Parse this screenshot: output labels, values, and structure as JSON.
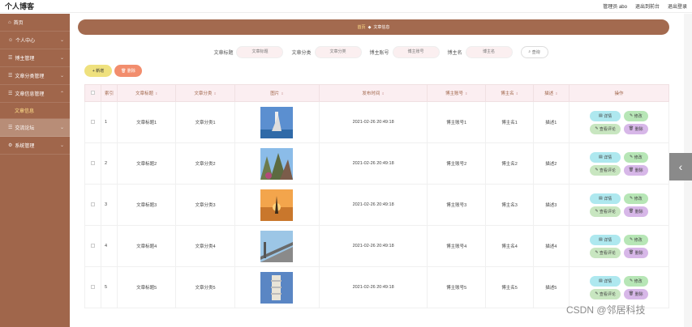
{
  "header": {
    "title": "个人博客",
    "admin": "管理员 abo",
    "back": "退出到前台",
    "logout": "退出登录"
  },
  "sidebar": {
    "items": [
      {
        "label": "首页",
        "icon": "home-icon"
      },
      {
        "label": "个人中心",
        "icon": "user-icon"
      },
      {
        "label": "博主管理",
        "icon": "list-icon"
      },
      {
        "label": "文章分类管理",
        "icon": "list-icon"
      },
      {
        "label": "文章信息管理",
        "icon": "list-icon"
      },
      {
        "label": "文章信息",
        "icon": ""
      },
      {
        "label": "交流论坛",
        "icon": "list-icon"
      },
      {
        "label": "系统管理",
        "icon": "gear-icon"
      }
    ]
  },
  "breadcrumb": {
    "home": "首页",
    "current": "文章信息"
  },
  "filters": {
    "title_label": "文章标题",
    "title_placeholder": "文章标题",
    "cat_label": "文章分类",
    "cat_placeholder": "文章分类",
    "acct_label": "博主账号",
    "acct_placeholder": "博主账号",
    "name_label": "博主名",
    "name_placeholder": "博主名",
    "search": "查询"
  },
  "actions": {
    "add": "新增",
    "delete": "删除"
  },
  "table": {
    "headers": [
      "索引",
      "文章标题",
      "文章分类",
      "图片",
      "发布时间",
      "博主账号",
      "博主名",
      "描述",
      "操作"
    ],
    "rows": [
      {
        "idx": "1",
        "title": "文章标题1",
        "cat": "文章分类1",
        "time": "2021-02-26 20:49:18",
        "acct": "博主账号1",
        "name": "博主名1",
        "desc": "描述1"
      },
      {
        "idx": "2",
        "title": "文章标题2",
        "cat": "文章分类2",
        "time": "2021-02-26 20:49:18",
        "acct": "博主账号2",
        "name": "博主名2",
        "desc": "描述2"
      },
      {
        "idx": "3",
        "title": "文章标题3",
        "cat": "文章分类3",
        "time": "2021-02-26 20:49:18",
        "acct": "博主账号3",
        "name": "博主名3",
        "desc": "描述3"
      },
      {
        "idx": "4",
        "title": "文章标题4",
        "cat": "文章分类4",
        "time": "2021-02-26 20:49:18",
        "acct": "博主账号4",
        "name": "博主名4",
        "desc": "描述4"
      },
      {
        "idx": "5",
        "title": "文章标题5",
        "cat": "文章分类5",
        "time": "2021-02-26 20:49:18",
        "acct": "博主账号5",
        "name": "博主名5",
        "desc": "描述5"
      }
    ],
    "ops": {
      "detail": "详情",
      "edit": "修改",
      "comment": "查看评论",
      "delete": "删除"
    }
  },
  "watermark": "CSDN @邻居科技",
  "colors": {
    "sidebar": "#a0664b",
    "breadcrumb": "#a36a4f",
    "add": "#efe17e",
    "delete": "#f28d6d"
  }
}
